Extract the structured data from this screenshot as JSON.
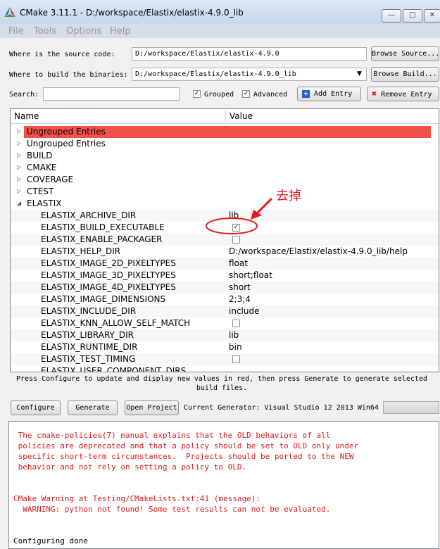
{
  "window": {
    "title": "CMake 3.11.1 - D:/workspace/Elastix/elastix-4.9.0_lib"
  },
  "menu": [
    "File",
    "Tools",
    "Options",
    "Help"
  ],
  "source": {
    "label": "Where is the source code:",
    "value": "D:/workspace/Elastix/elastix-4.9.0",
    "browse": "Browse Source..."
  },
  "build": {
    "label": "Where to build the binaries:",
    "value": "D:/workspace/Elastix/elastix-4.9.0_lib",
    "browse": "Browse Build..."
  },
  "search": {
    "label": "Search:",
    "value": ""
  },
  "options": {
    "grouped": "Grouped",
    "advanced": "Advanced",
    "add_entry": "Add Entry",
    "remove_entry": "Remove Entry"
  },
  "table": {
    "headers": {
      "name": "Name",
      "value": "Value"
    },
    "groups": [
      {
        "label": "Ungrouped Entries",
        "highlight": true
      },
      {
        "label": "Ungrouped Entries"
      },
      {
        "label": "BUILD"
      },
      {
        "label": "CMAKE"
      },
      {
        "label": "COVERAGE"
      },
      {
        "label": "CTEST"
      },
      {
        "label": "ELASTIX",
        "expanded": true
      }
    ],
    "entries": [
      {
        "name": "ELASTIX_ARCHIVE_DIR",
        "value": "lib"
      },
      {
        "name": "ELASTIX_BUILD_EXECUTABLE",
        "checkbox": true,
        "checked": true
      },
      {
        "name": "ELASTIX_ENABLE_PACKAGER",
        "checkbox": true,
        "checked": false
      },
      {
        "name": "ELASTIX_HELP_DIR",
        "value": "D:/workspace/Elastix/elastix-4.9.0_lib/help"
      },
      {
        "name": "ELASTIX_IMAGE_2D_PIXELTYPES",
        "value": "float"
      },
      {
        "name": "ELASTIX_IMAGE_3D_PIXELTYPES",
        "value": "short;float"
      },
      {
        "name": "ELASTIX_IMAGE_4D_PIXELTYPES",
        "value": "short"
      },
      {
        "name": "ELASTIX_IMAGE_DIMENSIONS",
        "value": "2;3;4"
      },
      {
        "name": "ELASTIX_INCLUDE_DIR",
        "value": "include"
      },
      {
        "name": "ELASTIX_KNN_ALLOW_SELF_MATCH",
        "checkbox": true,
        "checked": false
      },
      {
        "name": "ELASTIX_LIBRARY_DIR",
        "value": "lib"
      },
      {
        "name": "ELASTIX_RUNTIME_DIR",
        "value": "bin"
      },
      {
        "name": "ELASTIX_TEST_TIMING",
        "checkbox": true,
        "checked": false
      },
      {
        "name": "ELASTIX_USER_COMPONENT_DIRS",
        "value": ""
      }
    ]
  },
  "annotation": {
    "text": "去掉",
    "color": "#e8191b"
  },
  "status_text": "Press Configure to update and display new values in red, then press Generate to generate selected build files.",
  "actions": {
    "configure": "Configure",
    "generate": "Generate",
    "open_project": "Open Project",
    "generator": "Current Generator: Visual Studio 12 2013 Win64"
  },
  "log": [
    {
      "text": " The cmake-policies(7) manual explains that the OLD behaviors of all",
      "red": true
    },
    {
      "text": " policies are deprecated and that a policy should be set to OLD only under",
      "red": true
    },
    {
      "text": " specific short-term circumstances.  Projects should be ported to the NEW",
      "red": true
    },
    {
      "text": " behavior and not rely on setting a policy to OLD.",
      "red": true
    },
    {
      "text": "",
      "red": false
    },
    {
      "text": "",
      "red": false
    },
    {
      "text": "CMake Warning at Testing/CMakeLists.txt:41 (message):",
      "red": true
    },
    {
      "text": "  WARNING: python not found! Some test results can not be evaluated.",
      "red": true
    },
    {
      "text": "",
      "red": false
    },
    {
      "text": "",
      "red": false
    },
    {
      "text": "Configuring done",
      "red": false
    }
  ],
  "colors": {
    "highlight_row": "#f2504a",
    "accent_red": "#e0191b"
  }
}
